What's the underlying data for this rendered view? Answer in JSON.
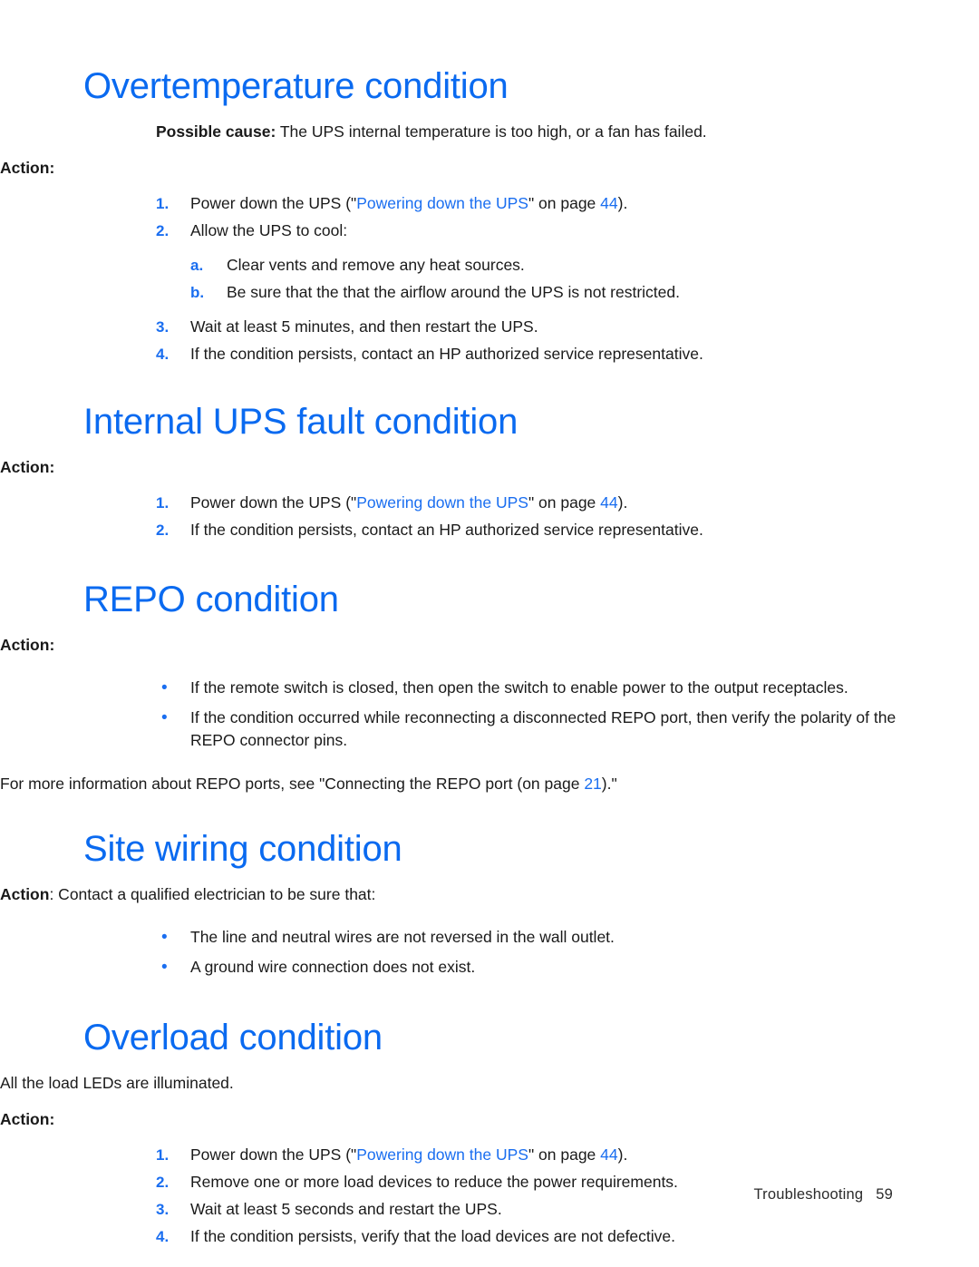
{
  "colors": {
    "heading_blue": "#0a6af0",
    "link_blue": "#1a6ef0",
    "marker_blue": "#1a6ef0",
    "body_black": "#1a1a1a"
  },
  "sections": [
    {
      "heading": "Overtemperature condition",
      "possible_cause_label": "Possible cause:",
      "possible_cause_text": " The UPS internal temperature is too high, or a fan has failed.",
      "action_label": "Action",
      "action_colon": ":",
      "items": [
        {
          "marker": "1.",
          "pre": "Power down the UPS (\"",
          "link": "Powering down the UPS",
          "mid": "\" on page ",
          "pagelink": "44",
          "post": ")."
        },
        {
          "marker": "2.",
          "text": "Allow the UPS to cool:",
          "sub": [
            {
              "marker": "a.",
              "text": "Clear vents and remove any heat sources."
            },
            {
              "marker": "b.",
              "text": "Be sure that the that the airflow around the UPS is not restricted."
            }
          ]
        },
        {
          "marker": "3.",
          "text": "Wait at least 5 minutes, and then restart the UPS."
        },
        {
          "marker": "4.",
          "text": "If the condition persists, contact an HP authorized service representative."
        }
      ]
    },
    {
      "heading": "Internal UPS fault condition",
      "action_label": "Action",
      "action_colon": ":",
      "items": [
        {
          "marker": "1.",
          "pre": "Power down the UPS (\"",
          "link": "Powering down the UPS",
          "mid": "\" on page ",
          "pagelink": "44",
          "post": ")."
        },
        {
          "marker": "2.",
          "text": "If the condition persists, contact an HP authorized service representative."
        }
      ]
    },
    {
      "heading": "REPO condition",
      "action_label": "Action",
      "action_colon": ":",
      "bullets": [
        {
          "marker": "•",
          "text": "If the remote switch is closed, then open the switch to enable power to the output receptacles."
        },
        {
          "marker": "•",
          "text": "If the condition occurred while reconnecting a disconnected REPO port, then verify the polarity of the REPO connector pins."
        }
      ],
      "trailing_pre": "For more information about REPO ports, see \"Connecting the REPO port (on page ",
      "trailing_link": "21",
      "trailing_post": ").\""
    },
    {
      "heading": "Site wiring condition",
      "action_label": "Action",
      "action_inline_text": ": Contact a qualified electrician to be sure that:",
      "bullets": [
        {
          "marker": "•",
          "text": "The line and neutral wires are not reversed in the wall outlet."
        },
        {
          "marker": "•",
          "text": "A ground wire connection does not exist."
        }
      ]
    },
    {
      "heading": "Overload condition",
      "intro": "All the load LEDs are illuminated.",
      "action_label": "Action",
      "action_colon": ":",
      "items": [
        {
          "marker": "1.",
          "pre": "Power down the UPS (\"",
          "link": "Powering down the UPS",
          "mid": "\" on page ",
          "pagelink": "44",
          "post": ")."
        },
        {
          "marker": "2.",
          "text": "Remove one or more load devices to reduce the power requirements."
        },
        {
          "marker": "3.",
          "text": "Wait at least 5 seconds and restart the UPS."
        },
        {
          "marker": "4.",
          "text": "If the condition persists, verify that the load devices are not defective."
        }
      ]
    }
  ],
  "footer": {
    "chapter": "Troubleshooting",
    "page_number": "59"
  }
}
